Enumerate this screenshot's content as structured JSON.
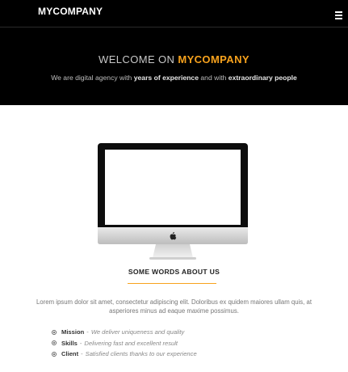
{
  "header": {
    "brand": "MYCOMPANY",
    "menu_icon": "hamburger-menu-icon"
  },
  "hero": {
    "title_prefix": "WELCOME ON ",
    "title_highlight": "MYCOMPANY",
    "sub_part1": "We are digital agency with ",
    "sub_bold1": "years of experience",
    "sub_part2": " and with ",
    "sub_bold2": "extraordinary people"
  },
  "about": {
    "image_icon": "imac-computer-image",
    "title": "SOME WORDS ABOUT US",
    "text": "Lorem ipsum dolor sit amet, consectetur adipiscing elit. Doloribus ex quidem maiores ullam quis, at asperiores minus ad eaque maxime possimus.",
    "features": [
      {
        "name": "Mission",
        "sep": "-",
        "desc": "We deliver uniqueness and quality"
      },
      {
        "name": "Skills",
        "sep": "-",
        "desc": "Delivering fast and excellent result"
      },
      {
        "name": "Client",
        "sep": "-",
        "desc": "Satisfied clients thanks to our experience"
      }
    ]
  },
  "colors": {
    "accent": "#f7a21d",
    "dark": "#000000"
  }
}
